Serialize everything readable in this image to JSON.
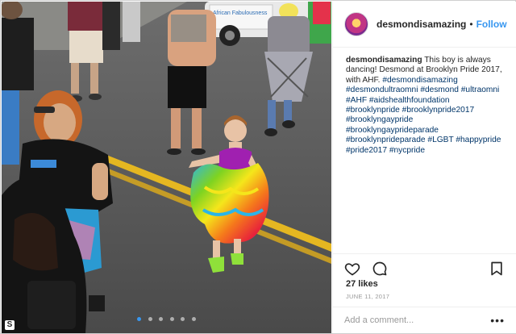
{
  "post": {
    "username": "desmondisamazing",
    "separator": "•",
    "follow_label": "Follow",
    "caption_user": "desmondisamazing",
    "caption_text": "This boy is always dancing! Desmond at Brooklyn Pride 2017, with AHF.",
    "hashtags": [
      "#desmondisamazing",
      "#desmondultraomni",
      "#desmond",
      "#ultraomni",
      "#AHF",
      "#aidshealthfoundation",
      "#brooklynpride",
      "#brooklynpride2017",
      "#brooklyngaypride",
      "#brooklyngayprideparade",
      "#brooklynprideparade",
      "#LGBT",
      "#happypride",
      "#pride2017",
      "#nycpride"
    ],
    "likes": "27 likes",
    "date": "JUNE 11, 2017",
    "comment_placeholder": "Add a comment...",
    "more_label": "•••"
  },
  "photo": {
    "van_sign": "African Fabulousness",
    "corner_badge": "S",
    "carousel_count": 6,
    "carousel_active": 0
  },
  "icons": {
    "like": "heart-icon",
    "comment": "comment-bubble-icon",
    "save": "bookmark-icon",
    "more": "more-dots-icon"
  },
  "colors": {
    "link": "#3897f0",
    "hashtag": "#003569",
    "text": "#262626",
    "muted": "#999999"
  }
}
